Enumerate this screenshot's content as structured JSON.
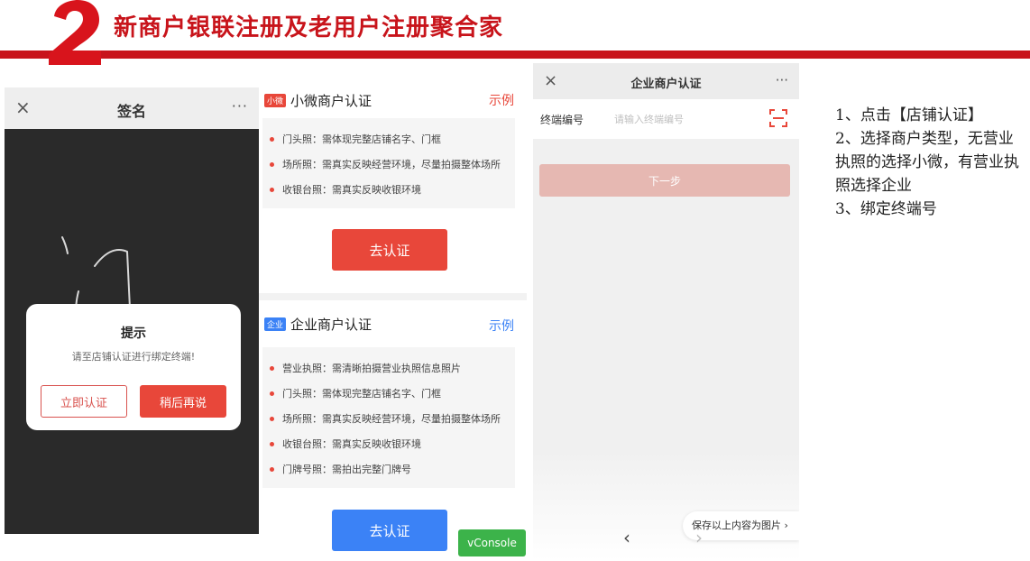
{
  "header": {
    "number": "2",
    "title": "新商户银联注册及老用户注册聚合家",
    "accent": "#c8141b"
  },
  "signature_screen": {
    "close_icon": "×",
    "title": "签名",
    "more_icon": "···",
    "dialog": {
      "title": "提示",
      "message": "请至店铺认证进行绑定终端!",
      "confirm_label": "立即认证",
      "later_label": "稍后再说"
    }
  },
  "auth_screen": {
    "micro": {
      "tag": "小微",
      "title": "小微商户认证",
      "example": "示例",
      "requirements": [
        "门头照：需体现完整店铺名字、门框",
        "场所照：需真实反映经营环境，尽量拍摄整体场所",
        "收银台照：需真实反映收银环境"
      ],
      "button_label": "去认证"
    },
    "enterprise": {
      "tag": "企业",
      "title": "企业商户认证",
      "example": "示例",
      "requirements": [
        "营业执照：需清晰拍摄营业执照信息照片",
        "门头照：需体现完整店铺名字、门框",
        "场所照：需真实反映经营环境，尽量拍摄整体场所",
        "收银台照：需真实反映收银环境",
        "门牌号照：需拍出完整门牌号"
      ],
      "button_label": "去认证"
    },
    "vconsole_label": "vConsole"
  },
  "enterprise_screen": {
    "close_icon": "×",
    "title": "企业商户认证",
    "more_icon": "···",
    "terminal_label": "终端编号",
    "terminal_placeholder": "请输入终端编号",
    "terminal_value": "",
    "next_label": "下一步",
    "save_label": "保存以上内容为图片 ›",
    "back_icon": "‹",
    "forward_icon": "›"
  },
  "steps": [
    "1、点击【店铺认证】",
    "2、选择商户类型，无营业执照的选择小微，有营业执照选择企业",
    "3、绑定终端号"
  ],
  "colors": {
    "red": "#e8473a",
    "blue": "#3b82f6",
    "green": "#3cb34a",
    "disabled_red": "#e6b8b2"
  }
}
